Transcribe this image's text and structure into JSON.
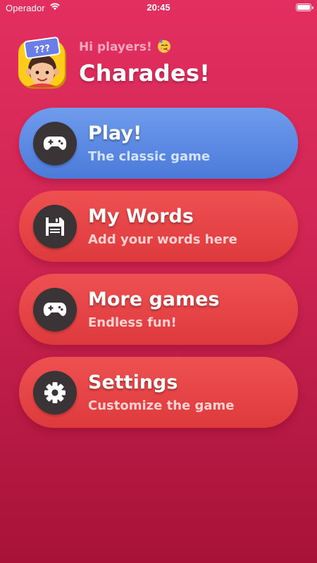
{
  "status_bar": {
    "carrier": "Operador",
    "time": "20:45",
    "wifi_icon": "wifi-icon",
    "battery_icon": "battery-icon"
  },
  "header": {
    "greeting": "Hi players!",
    "greeting_emoji": "🥳",
    "title": "Charades!",
    "logo_icon": "charades-logo",
    "logo_card_text": "???"
  },
  "menu": [
    {
      "id": "play",
      "title": "Play!",
      "subtitle": "The classic game",
      "icon": "gamepad-icon",
      "style": "primary"
    },
    {
      "id": "my-words",
      "title": "My Words",
      "subtitle": "Add your words here",
      "icon": "save-icon",
      "style": "secondary"
    },
    {
      "id": "more-games",
      "title": "More games",
      "subtitle": "Endless fun!",
      "icon": "gamepad-icon",
      "style": "secondary"
    },
    {
      "id": "settings",
      "title": "Settings",
      "subtitle": "Customize the game",
      "icon": "gear-icon",
      "style": "secondary"
    }
  ],
  "colors": {
    "background_top": "#E22F60",
    "background_bottom": "#A81238",
    "primary_card": "#5F8BE3",
    "secondary_card": "#E54446",
    "icon_circle": "#3A3437",
    "greeting": "#F8A7BC"
  }
}
